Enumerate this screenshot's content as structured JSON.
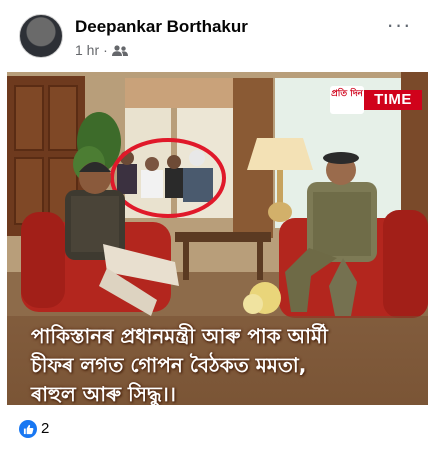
{
  "post": {
    "author": "Deepankar Borthakur",
    "time": "1 hr",
    "separator": "·",
    "privacy_icon": "friends-icon",
    "more_icon": "more-options-icon",
    "more_label": "···"
  },
  "image": {
    "logo_badge": "প্ৰতি দিন",
    "logo_text": "TIME",
    "caption_lines": [
      "পাকিস্তানৰ প্ৰধানমন্ত্ৰী আৰু পাক আৰ্মী",
      "চীফৰ লগত গোপন বৈঠকত মমতা,",
      "ৰাহুল আৰু সিদ্ধু।।"
    ]
  },
  "reactions": {
    "icon": "like-icon",
    "count": "2"
  },
  "colors": {
    "brand_red": "#d0021b",
    "like_blue": "#1877f2",
    "secondary_text": "#65676b"
  }
}
